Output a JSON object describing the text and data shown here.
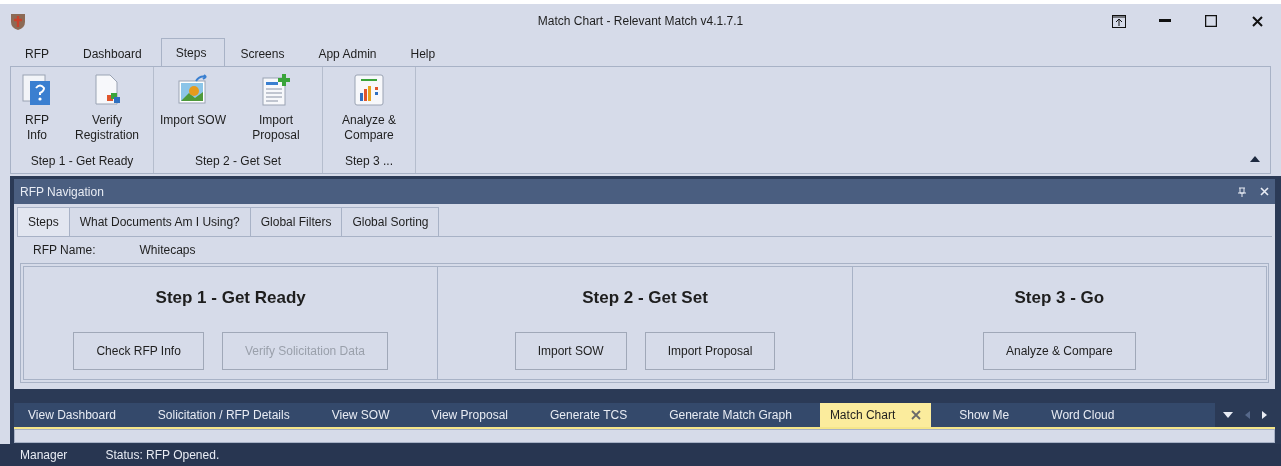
{
  "window": {
    "title": "Match Chart - Relevant Match v4.1.7.1"
  },
  "menu_tabs": [
    {
      "label": "RFP",
      "selected": false
    },
    {
      "label": "Dashboard",
      "selected": false
    },
    {
      "label": "Steps",
      "selected": true
    },
    {
      "label": "Screens",
      "selected": false
    },
    {
      "label": "App Admin",
      "selected": false
    },
    {
      "label": "Help",
      "selected": false
    }
  ],
  "ribbon_groups": [
    {
      "label": "Step 1 - Get Ready",
      "items": [
        {
          "label": "RFP Info",
          "kind": "info"
        },
        {
          "label": "Verify Registration",
          "kind": "document"
        }
      ]
    },
    {
      "label": "Step 2 - Get Set",
      "items": [
        {
          "label": "Import SOW",
          "kind": "image"
        },
        {
          "label": "Import Proposal",
          "kind": "proposal"
        }
      ]
    },
    {
      "label": "Step 3 ...",
      "items": [
        {
          "label": "Analyze & Compare",
          "kind": "chart"
        }
      ]
    }
  ],
  "panel": {
    "title": "RFP Navigation",
    "tabs": [
      {
        "label": "Steps",
        "selected": true
      },
      {
        "label": "What Documents Am I Using?",
        "selected": false
      },
      {
        "label": "Global Filters",
        "selected": false
      },
      {
        "label": "Global Sorting",
        "selected": false
      }
    ],
    "rfp_name_label": "RFP Name:",
    "rfp_name": "Whitecaps",
    "steps": [
      {
        "title": "Step 1 - Get Ready",
        "buttons": [
          {
            "label": "Check RFP Info",
            "disabled": false
          },
          {
            "label": "Verify Solicitation Data",
            "disabled": true
          }
        ]
      },
      {
        "title": "Step 2 - Get Set",
        "buttons": [
          {
            "label": "Import SOW",
            "disabled": false
          },
          {
            "label": "Import Proposal",
            "disabled": false
          }
        ]
      },
      {
        "title": "Step 3 - Go",
        "buttons": [
          {
            "label": "Analyze & Compare",
            "disabled": false
          }
        ]
      }
    ]
  },
  "document_tabs": [
    {
      "label": "View Dashboard",
      "selected": false
    },
    {
      "label": "Solicitation / RFP Details",
      "selected": false
    },
    {
      "label": "View SOW",
      "selected": false
    },
    {
      "label": "View Proposal",
      "selected": false
    },
    {
      "label": "Generate TCS",
      "selected": false
    },
    {
      "label": "Generate Match Graph",
      "selected": false
    },
    {
      "label": "Match Chart",
      "selected": true
    },
    {
      "label": "Show Me",
      "selected": false
    },
    {
      "label": "Word Cloud",
      "selected": false
    }
  ],
  "status_bar": {
    "user": "Manager",
    "status": "Status: RFP Opened."
  }
}
